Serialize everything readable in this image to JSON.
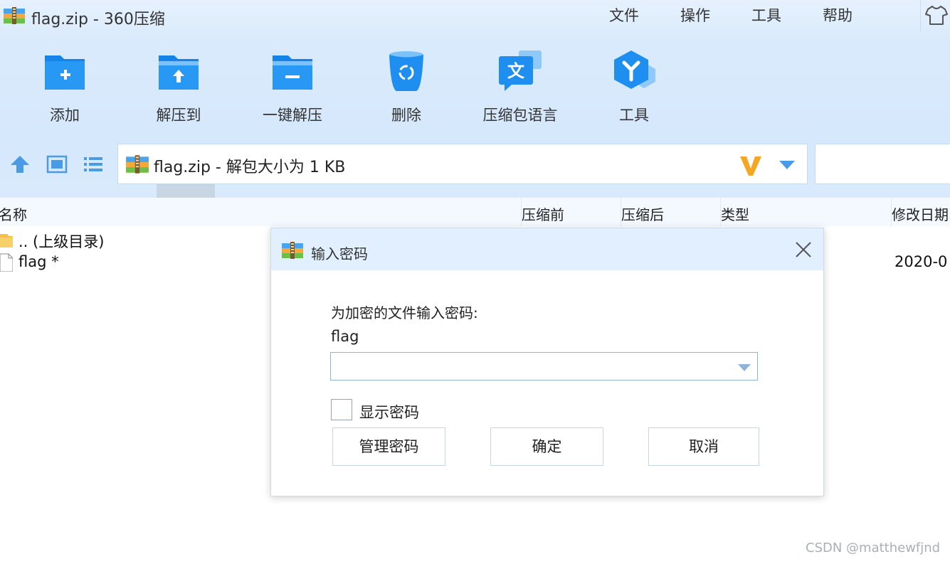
{
  "window": {
    "title": "flag.zip - 360压缩",
    "menu": [
      "文件",
      "操作",
      "工具",
      "帮助"
    ]
  },
  "toolbar": {
    "buttons": [
      {
        "label": "添加",
        "icon": "folder-add-icon"
      },
      {
        "label": "解压到",
        "icon": "folder-extract-icon"
      },
      {
        "label": "一键解压",
        "icon": "folder-one-click-icon"
      },
      {
        "label": "删除",
        "icon": "recycle-bin-icon"
      },
      {
        "label": "压缩包语言",
        "icon": "language-icon"
      },
      {
        "label": "工具",
        "icon": "tools-hexagon-icon"
      }
    ]
  },
  "address_bar": {
    "text": "flag.zip - 解包大小为 1 KB"
  },
  "file_list": {
    "columns": [
      "名称",
      "压缩前",
      "压缩后",
      "类型",
      "修改日期"
    ],
    "rows": [
      {
        "name": ".. (上级目录)",
        "icon": "folder-icon",
        "date": ""
      },
      {
        "name": "flag *",
        "icon": "file-icon",
        "date": "2020-0"
      }
    ]
  },
  "dialog": {
    "title": "输入密码",
    "prompt": "为加密的文件输入密码:",
    "filename": "flag",
    "password_value": "",
    "show_password_label": "显示密码",
    "show_password_checked": false,
    "buttons": {
      "manage": "管理密码",
      "ok": "确定",
      "cancel": "取消"
    }
  },
  "watermark": "CSDN @matthewfjnd",
  "colors": {
    "chrome_background": "#d9eafc",
    "icon_blue": "#1e8ff0",
    "dialog_titlebar": "#e2efff",
    "brand_v": "#f5a623"
  }
}
